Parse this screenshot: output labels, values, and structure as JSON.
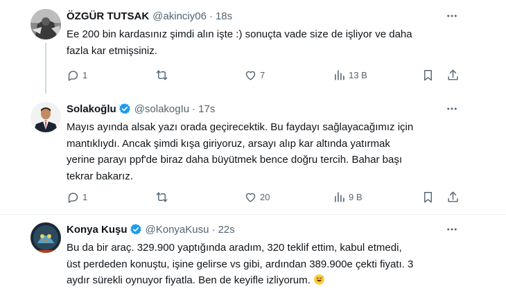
{
  "tweets": [
    {
      "name": "ÖZGÜR TUTSAK",
      "handle": "@akinciy06",
      "time": "18s",
      "verified": false,
      "text_lines": [
        "Ee 200 bin kardasınız şimdi alın işte :) sonuçta vade size de işliyor ve daha",
        "fazla kar etmişsiniz."
      ],
      "replies": "1",
      "retweets": "",
      "likes": "7",
      "views": "13 B"
    },
    {
      "name": "Solakoğlu",
      "handle": "@solakogIu",
      "time": "17s",
      "verified": true,
      "text_lines": [
        "Mayıs ayında alsak yazı orada geçirecektik. Bu faydayı sağlayacağımız için",
        "mantıklıydı. Ancak şimdi kışa giriyoruz, arsayı alıp kar altında yatırmak",
        "yerine parayı ppf'de biraz daha büyütmek bence doğru tercih. Bahar başı",
        "tekrar bakarız."
      ],
      "replies": "1",
      "retweets": "",
      "likes": "20",
      "views": "9 B"
    },
    {
      "name": "Konya Kuşu",
      "handle": "@KonyaKusu",
      "time": "22s",
      "verified": true,
      "text_lines": [
        "Bu da bir araç. 329.900 yaptığında aradım, 320 teklif ettim, kabul etmedi,",
        "üst perdeden konuştu, işine gelirse vs gibi, ardından 389.900e çekti fiyatı. 3",
        "aydır sürekli oynuyor fiyatla. Ben de keyifle izliyorum."
      ],
      "emoji": "grinning-sweat-emoji"
    }
  ],
  "separator": "·",
  "colors": {
    "text": "#0f1419",
    "secondary": "#536471",
    "verified": "#1d9bf0",
    "divider": "#eff3f4",
    "thread_line": "#cfd9de"
  }
}
